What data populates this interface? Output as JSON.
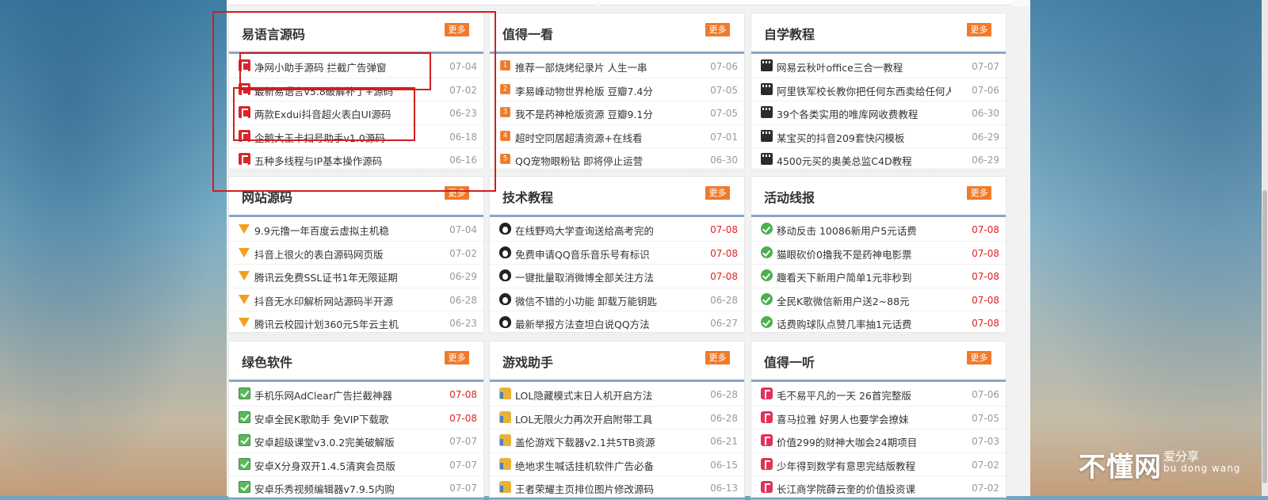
{
  "more_label": "更多",
  "panels": [
    {
      "title": "易语言源码",
      "items": [
        {
          "icon": "e-lang-icon",
          "text": "净网小助手源码 拦截广告弹窗",
          "date": "07-04"
        },
        {
          "icon": "e-lang-icon",
          "text": "最新易语言v5.8破解补丁+源码",
          "date": "07-02"
        },
        {
          "icon": "e-lang-icon",
          "text": "两款Exdui抖音超火表白UI源码",
          "date": "06-23"
        },
        {
          "icon": "e-lang-icon",
          "text": "企鹅大王卡扫号助手v1.0源码",
          "date": "06-18"
        },
        {
          "icon": "e-lang-icon",
          "text": "五种多线程与IP基本操作源码",
          "date": "06-16"
        }
      ]
    },
    {
      "title": "值得一看",
      "items": [
        {
          "icon": "number-icon",
          "num": "1",
          "text": "推荐一部烧烤纪录片 人生一串",
          "date": "07-06"
        },
        {
          "icon": "number-icon",
          "num": "2",
          "text": "李易峰动物世界枪版 豆瓣7.4分",
          "date": "07-05"
        },
        {
          "icon": "number-icon",
          "num": "3",
          "text": "我不是药神枪版资源 豆瓣9.1分",
          "date": "07-05"
        },
        {
          "icon": "number-icon",
          "num": "4",
          "text": "超时空同居超清资源+在线看",
          "date": "07-01"
        },
        {
          "icon": "number-icon",
          "num": "5",
          "text": "QQ宠物眼粉钻 即将停止运营",
          "date": "06-30"
        }
      ]
    },
    {
      "title": "自学教程",
      "items": [
        {
          "icon": "film-icon",
          "text": "网易云秋叶office三合一教程",
          "date": "07-07"
        },
        {
          "icon": "film-icon",
          "text": "阿里铁军校长教你把任何东西卖给任何人",
          "date": "07-06"
        },
        {
          "icon": "film-icon",
          "text": "39个各类实用的唯库网收费教程",
          "date": "06-30"
        },
        {
          "icon": "film-icon",
          "text": "某宝买的抖音209套快闪模板",
          "date": "06-29"
        },
        {
          "icon": "film-icon",
          "text": "4500元买的奥美总监C4D教程",
          "date": "06-29"
        }
      ]
    },
    {
      "title": "网站源码",
      "items": [
        {
          "icon": "diamond-icon",
          "text": "9.9元撸一年百度云虚拟主机稳",
          "date": "07-04"
        },
        {
          "icon": "diamond-icon",
          "text": "抖音上很火的表白源码网页版",
          "date": "07-02"
        },
        {
          "icon": "diamond-icon",
          "text": "腾讯云免费SSL证书1年无限延期",
          "date": "06-29"
        },
        {
          "icon": "diamond-icon",
          "text": "抖音无水印解析网站源码半开源",
          "date": "06-28"
        },
        {
          "icon": "diamond-icon",
          "text": "腾讯云校园计划360元5年云主机",
          "date": "06-23"
        }
      ]
    },
    {
      "title": "技术教程",
      "items": [
        {
          "icon": "penguin-icon",
          "text": "在线野鸡大学查询送给高考完的",
          "date": "07-08",
          "hot": true
        },
        {
          "icon": "penguin-icon",
          "text": "免费申请QQ音乐音乐号有标识",
          "date": "07-08",
          "hot": true
        },
        {
          "icon": "penguin-icon",
          "text": "一键批量取消微博全部关注方法",
          "date": "07-08",
          "hot": true
        },
        {
          "icon": "penguin-icon",
          "text": "微信不错的小功能 卸载万能钥匙",
          "date": "06-28"
        },
        {
          "icon": "penguin-icon",
          "text": "最新举报方法查坦白说QQ方法",
          "date": "06-27"
        }
      ]
    },
    {
      "title": "活动线报",
      "items": [
        {
          "icon": "check-circle-icon",
          "text": "移动反击 10086新用户5元话费",
          "date": "07-08",
          "hot": true
        },
        {
          "icon": "check-circle-icon",
          "text": "猫眼砍价0撸我不是药神电影票",
          "date": "07-08",
          "hot": true
        },
        {
          "icon": "check-circle-icon",
          "text": "趣看天下新用户简单1元非秒到",
          "date": "07-08",
          "hot": true
        },
        {
          "icon": "check-circle-icon",
          "text": "全民K歌微信新用户送2~88元",
          "date": "07-08",
          "hot": true
        },
        {
          "icon": "check-circle-icon",
          "text": "话费购球队点赞几率抽1元话费",
          "date": "07-08",
          "hot": true
        }
      ]
    },
    {
      "title": "绿色软件",
      "items": [
        {
          "icon": "checkbox-icon",
          "text": "手机乐网AdClear广告拦截神器",
          "date": "07-08",
          "hot": true
        },
        {
          "icon": "checkbox-icon",
          "text": "安卓全民K歌助手 免VIP下载歌",
          "date": "07-08",
          "hot": true
        },
        {
          "icon": "checkbox-icon",
          "text": "安卓超级课堂v3.0.2完美破解版",
          "date": "07-07"
        },
        {
          "icon": "checkbox-icon",
          "text": "安卓X分身双开1.4.5清爽会员版",
          "date": "07-07"
        },
        {
          "icon": "checkbox-icon",
          "text": "安卓乐秀视频编辑器v7.9.5内购",
          "date": "07-07"
        }
      ]
    },
    {
      "title": "游戏助手",
      "items": [
        {
          "icon": "thumbs-up-icon",
          "text": "LOL隐藏模式末日人机开启方法",
          "date": "06-28"
        },
        {
          "icon": "thumbs-up-icon",
          "text": "LOL无限火力再次开启附带工具",
          "date": "06-28"
        },
        {
          "icon": "thumbs-up-icon",
          "text": "盖伦游戏下载器v2.1共5TB资源",
          "date": "06-21"
        },
        {
          "icon": "thumbs-up-icon",
          "text": "绝地求生喊话挂机软件广告必备",
          "date": "06-15"
        },
        {
          "icon": "thumbs-up-icon",
          "text": "王者荣耀主页排位图片修改源码",
          "date": "06-13"
        }
      ]
    },
    {
      "title": "值得一听",
      "items": [
        {
          "icon": "music-icon",
          "text": "毛不易平凡的一天 26首完整版",
          "date": "07-06"
        },
        {
          "icon": "music-icon",
          "text": "喜马拉雅 好男人也要学会撩妹",
          "date": "07-05"
        },
        {
          "icon": "music-icon",
          "text": "价值299的财神大咖会24期项目",
          "date": "07-03"
        },
        {
          "icon": "music-icon",
          "text": "少年得到数学有意思完结版教程",
          "date": "07-02"
        },
        {
          "icon": "music-icon",
          "text": "长江商学院薛云奎的价值投资课",
          "date": "07-02"
        }
      ]
    }
  ],
  "watermark": {
    "big": "不懂网",
    "small1": "爱分享",
    "small2": "bu dong wang"
  },
  "colors": {
    "accent": "#f07a2a",
    "hot_date": "#e02222",
    "highlight_box": "#cf1f1f",
    "underline": "#8aa5c8"
  }
}
